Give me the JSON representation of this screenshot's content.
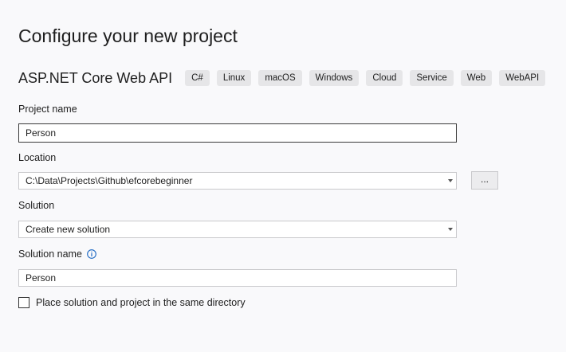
{
  "page": {
    "title": "Configure your new project"
  },
  "template": {
    "name": "ASP.NET Core Web API",
    "tags": [
      "C#",
      "Linux",
      "macOS",
      "Windows",
      "Cloud",
      "Service",
      "Web",
      "WebAPI"
    ]
  },
  "project_name": {
    "label": "Project name",
    "value": "Person"
  },
  "location": {
    "label": "Location",
    "value": "C:\\Data\\Projects\\Github\\efcorebeginner",
    "browse_label": "..."
  },
  "solution": {
    "label": "Solution",
    "value": "Create new solution"
  },
  "solution_name": {
    "label": "Solution name",
    "value": "Person",
    "info_icon": "info-icon"
  },
  "same_directory": {
    "label": "Place solution and project in the same directory",
    "checked": false
  },
  "colors": {
    "background": "#f9f9fb",
    "tag_background": "#e6e6e8",
    "info_icon": "#1a66c2"
  }
}
